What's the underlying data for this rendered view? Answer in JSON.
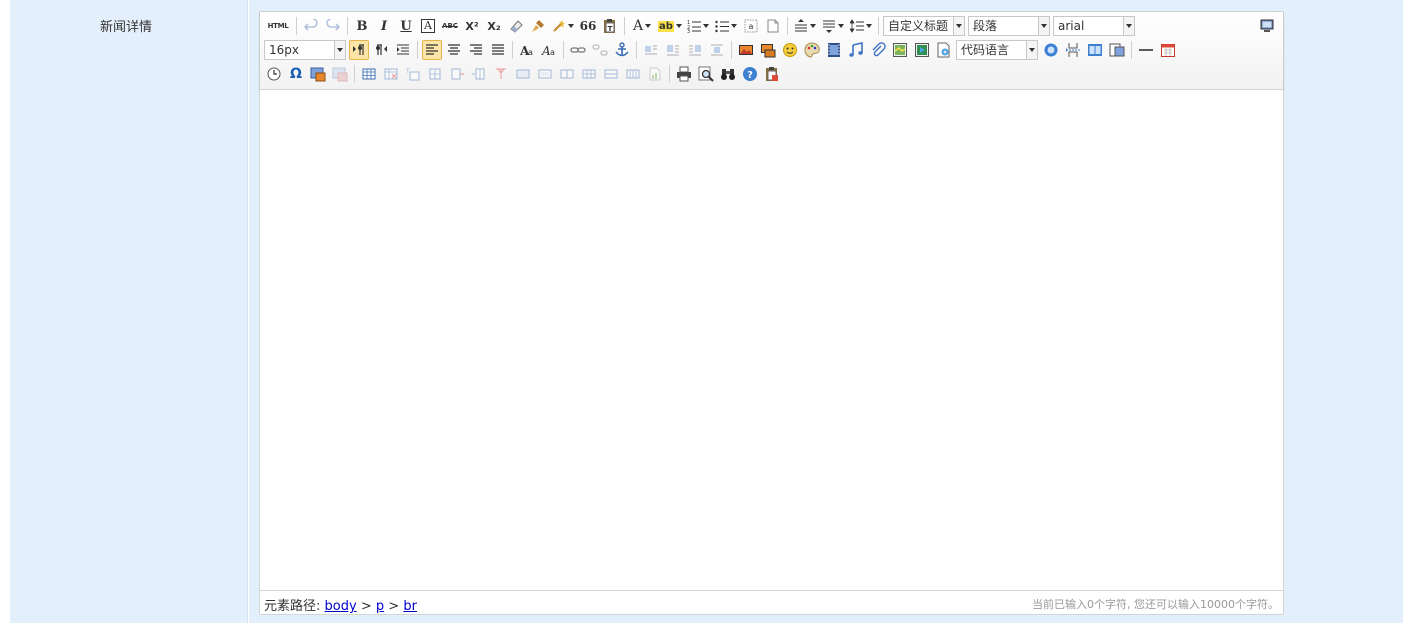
{
  "form": {
    "field_label": "新闻详情"
  },
  "toolbar": {
    "html_label": "HTML",
    "bold_label": "B",
    "italic_label": "I",
    "underline_label": "U",
    "fontborder_label": "A",
    "strikethrough_label": "ABC",
    "superscript_label": "X²",
    "subscript_label": "X₂",
    "blockquote_label": "66",
    "forecolor_label": "A",
    "backcolor_label": "ab",
    "customstyle_value": "自定义标题",
    "paragraph_value": "段落",
    "fontfamily_value": "arial",
    "fontsize_value": "16px",
    "codelanguage_value": "代码语言",
    "omega_label": "Ω"
  },
  "statusbar": {
    "path_prefix": "元素路径:",
    "path_items": [
      "body",
      "p",
      "br"
    ],
    "path_separator": ">",
    "wordcount": "当前已输入0个字符, 您还可以输入10000个字符。"
  },
  "colors": {
    "panel_bg": "#e3effb",
    "active_bg": "#fde5a8",
    "link": "#0000cc"
  }
}
